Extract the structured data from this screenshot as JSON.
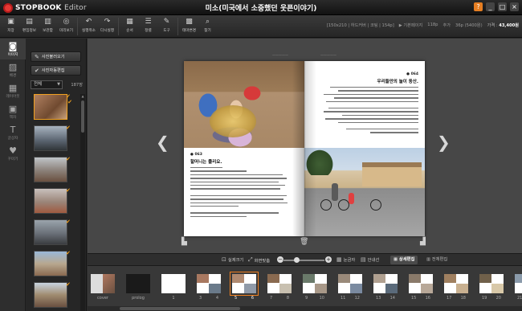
{
  "app": {
    "logo_text": "STOPBOOK",
    "logo_suffix": "Editor",
    "doc_title": "미소(미국에서 소중했던 웃픈이야기)",
    "window_buttons": {
      "help": "?",
      "minimize": "_",
      "maximize": "□",
      "close": "×"
    }
  },
  "toolbar": {
    "tools": [
      {
        "name": "save",
        "label": "저장",
        "icon": "save-icon",
        "glyph": "▣"
      },
      {
        "name": "edit-info",
        "label": "편집정보",
        "icon": "document-icon",
        "glyph": "▤"
      },
      {
        "name": "storage",
        "label": "보관함",
        "icon": "box-icon",
        "glyph": "▥"
      },
      {
        "name": "preview",
        "label": "미리보기",
        "icon": "eye-icon",
        "glyph": "◎"
      },
      {
        "name": "undo",
        "label": "실행취소",
        "icon": "undo-icon",
        "glyph": "↶"
      },
      {
        "name": "redo",
        "label": "다시실행",
        "icon": "redo-icon",
        "glyph": "↷"
      },
      {
        "name": "order",
        "label": "순서",
        "icon": "order-icon",
        "glyph": "▦"
      },
      {
        "name": "align",
        "label": "정렬",
        "icon": "align-icon",
        "glyph": "☰"
      },
      {
        "name": "tools",
        "label": "도구",
        "icon": "wrench-icon",
        "glyph": "✎"
      },
      {
        "name": "theme",
        "label": "테마변경",
        "icon": "theme-icon",
        "glyph": "▩"
      },
      {
        "name": "find",
        "label": "찾기",
        "icon": "search-icon",
        "glyph": "⌕"
      }
    ],
    "info": {
      "size": "150x210",
      "cover": "하드커버",
      "finish": "코팅",
      "weight": "154p",
      "spread_mode": "기본페이지",
      "pages": "118p",
      "add": "추가",
      "extra": "36p (5400원)",
      "price_label": "가격",
      "price": "43,400원"
    }
  },
  "rail": {
    "items": [
      {
        "name": "image",
        "label": "이미지",
        "glyph": "◙",
        "active": true
      },
      {
        "name": "background",
        "label": "배경",
        "glyph": "▨",
        "active": false
      },
      {
        "name": "layout",
        "label": "레이아웃",
        "glyph": "▦",
        "active": false
      },
      {
        "name": "frame",
        "label": "액자",
        "glyph": "▣",
        "active": false
      },
      {
        "name": "text",
        "label": "글상자",
        "glyph": "T",
        "active": false
      },
      {
        "name": "decoration",
        "label": "꾸미기",
        "glyph": "♥",
        "active": false
      }
    ]
  },
  "photo_panel": {
    "load_button": "사진불러오기",
    "edit_button": "사진자동편집",
    "filter_value": "전체",
    "count": "187장"
  },
  "workspace": {
    "left_page": {
      "number": "● 063",
      "title": "할머니는 졸리요."
    },
    "right_page": {
      "number": "● 064",
      "title": "우리들만의 놀이 동산."
    }
  },
  "controls": {
    "real_size": "실제크기",
    "fit_screen": "화면맞춤",
    "ruler": "눈금자",
    "guide": "안내선",
    "detail_edit": "상세편집",
    "full_edit": "전체편집"
  },
  "filmstrip": {
    "spreads": [
      {
        "labels": [
          "cover"
        ],
        "type": "cover"
      },
      {
        "labels": [
          "prolog"
        ],
        "type": "prolog"
      },
      {
        "labels": [
          "1"
        ],
        "type": "blank"
      },
      {
        "labels": [
          "3",
          "4"
        ],
        "type": "photo"
      },
      {
        "labels": [
          "5",
          "6"
        ],
        "type": "photo",
        "selected": true
      },
      {
        "labels": [
          "7",
          "8"
        ],
        "type": "photo"
      },
      {
        "labels": [
          "9",
          "10"
        ],
        "type": "photo"
      },
      {
        "labels": [
          "11",
          "12"
        ],
        "type": "photo"
      },
      {
        "labels": [
          "13",
          "14"
        ],
        "type": "photo"
      },
      {
        "labels": [
          "15",
          "16"
        ],
        "type": "photo"
      },
      {
        "labels": [
          "17",
          "18"
        ],
        "type": "photo"
      },
      {
        "labels": [
          "19",
          "20"
        ],
        "type": "photo"
      },
      {
        "labels": [
          "21",
          "22"
        ],
        "type": "photo"
      }
    ]
  },
  "colors": {
    "accent": "#f08020",
    "check": "#f0a020",
    "brand_red": "#e53935"
  }
}
